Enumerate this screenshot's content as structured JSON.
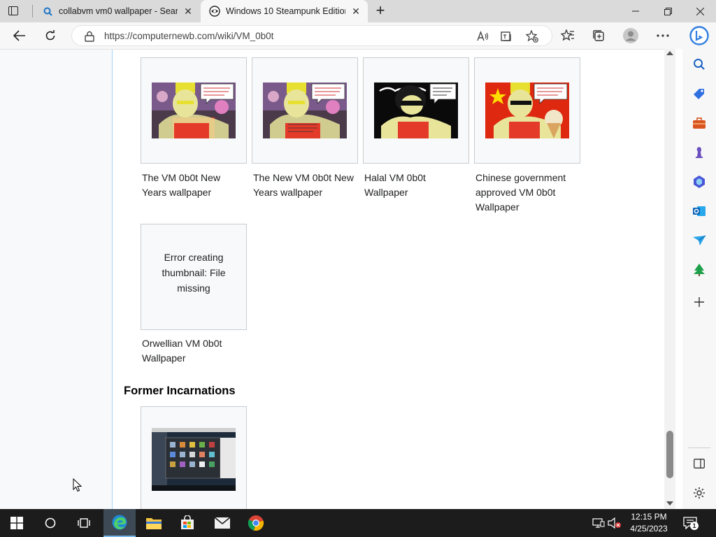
{
  "browser": {
    "tabs": [
      {
        "title": "collabvm vm0 wallpaper - Search",
        "active": false
      },
      {
        "title": "Windows 10 Steampunk Edition - ",
        "active": true
      }
    ],
    "address": "https://computernewb.com/wiki/VM_0b0t"
  },
  "gallery": {
    "items": [
      {
        "caption": "The VM 0b0t New Years wallpaper"
      },
      {
        "caption": "The New VM 0b0t New Years wallpaper"
      },
      {
        "caption": "Halal VM 0b0t Wallpaper"
      },
      {
        "caption": "Chinese government approved VM 0b0t Wallpaper"
      },
      {
        "caption": "Orwellian VM 0b0t Wallpaper",
        "error": "Error creating thumbnail: File missing"
      }
    ]
  },
  "section": {
    "heading": "Former Incarnations"
  },
  "taskbar": {
    "time": "12:15 PM",
    "date": "4/25/2023",
    "notification_count": "1"
  },
  "colors": {
    "accent": "#0078d4",
    "link_border": "#a7d7f9",
    "taskbar": "#1c1c1c"
  }
}
